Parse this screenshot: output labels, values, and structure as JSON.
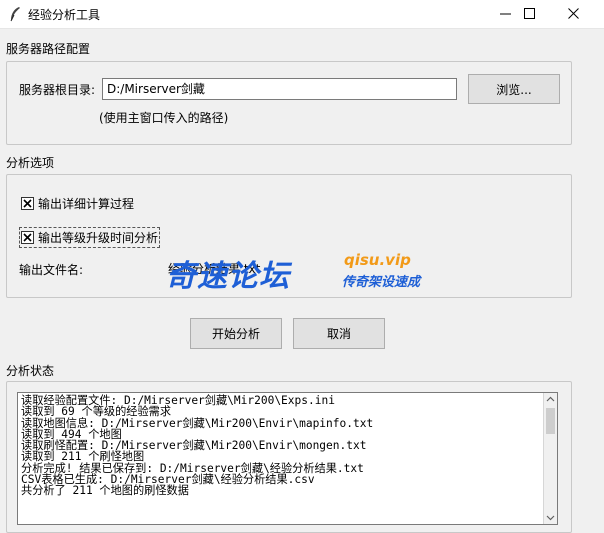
{
  "window": {
    "title": "经验分析工具"
  },
  "server_section": {
    "heading": "服务器路径配置",
    "root_label": "服务器根目录:",
    "root_value": "D:/Mirserver剑藏",
    "browse_label": "浏览...",
    "hint": "(使用主窗口传入的路径)"
  },
  "options_section": {
    "heading": "分析选项",
    "detail_checkbox_label": "输出详细计算过程",
    "detail_checked": true,
    "level_checkbox_label": "输出等级升级时间分析",
    "level_checked": true,
    "output_label": "输出文件名:",
    "output_value": "经验分析结果.txt"
  },
  "actions": {
    "start_label": "开始分析",
    "cancel_label": "取消"
  },
  "status_section": {
    "heading": "分析状态",
    "log": [
      "读取经验配置文件: D:/Mirserver剑藏\\Mir200\\Exps.ini",
      "读取到 69 个等级的经验需求",
      "读取地图信息: D:/Mirserver剑藏\\Mir200\\Envir\\mapinfo.txt",
      "读取到 494 个地图",
      "读取刷怪配置: D:/Mirserver剑藏\\Mir200\\Envir\\mongen.txt",
      "读取到 211 个刷怪地图",
      "分析完成! 结果已保存到: D:/Mirserver剑藏\\经验分析结果.txt",
      "CSV表格已生成: D:/Mirserver剑藏\\经验分析结果.csv",
      "共分析了 211 个地图的刷怪数据"
    ]
  },
  "watermark": {
    "main": "奇速论坛",
    "url": "qisu.vip",
    "sub": "传奇架设速成"
  }
}
